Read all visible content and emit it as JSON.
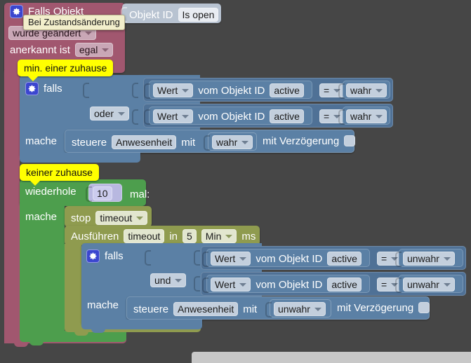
{
  "workspace": {
    "background_color": "#464646",
    "tooltip": "Bei Zustandsänderung"
  },
  "trigger_block": {
    "color": "#a1576f",
    "gear_icon": "gear-icon",
    "title": "Falls Objekt",
    "change_mode": "wurde geändert",
    "ack_label": "anerkannt ist",
    "ack_value": "egal",
    "object_input": {
      "label": "Objekt ID",
      "value": "Is open",
      "color": "#b8c3d1"
    }
  },
  "comments": {
    "first": "min. einer zuhause",
    "second": "keiner zuhause"
  },
  "if_block_1": {
    "color": "#5b80a5",
    "gear_icon": "gear-icon",
    "if_label": "falls",
    "operator": "oder",
    "do_label": "mache",
    "conditions": [
      {
        "value_label": "Wert",
        "text": "vom Objekt ID",
        "object_id": "active",
        "comparator": "=",
        "compare_to": "wahr"
      },
      {
        "value_label": "Wert",
        "text": "vom Objekt ID",
        "object_id": "active",
        "comparator": "=",
        "compare_to": "wahr"
      }
    ],
    "action": {
      "verb": "steuere",
      "target": "Anwesenheit",
      "with_label": "mit",
      "value": "wahr",
      "delay_label": "mit Verzögerung",
      "delay_checked": false
    }
  },
  "repeat_block": {
    "color": "#4d9e4d",
    "repeat_label": "wiederhole",
    "times": "10",
    "times_suffix": "mal:",
    "do_label": "mache"
  },
  "stop_block": {
    "color": "#8f9b4f",
    "label": "stop",
    "timer_name": "timeout"
  },
  "exec_block": {
    "color": "#8f9b4f",
    "label": "Ausführen",
    "timer_name": "timeout",
    "in_label": "in",
    "amount": "5",
    "unit": "Min",
    "unit_suffix": "ms"
  },
  "if_block_2": {
    "color": "#5b80a5",
    "gear_icon": "gear-icon",
    "if_label": "falls",
    "operator": "und",
    "do_label": "mache",
    "conditions": [
      {
        "value_label": "Wert",
        "text": "vom Objekt ID",
        "object_id": "active",
        "comparator": "=",
        "compare_to": "unwahr"
      },
      {
        "value_label": "Wert",
        "text": "vom Objekt ID",
        "object_id": "active",
        "comparator": "=",
        "compare_to": "unwahr"
      }
    ],
    "action": {
      "verb": "steuere",
      "target": "Anwesenheit",
      "with_label": "mit",
      "value": "unwahr",
      "delay_label": "mit Verzögerung",
      "delay_checked": false
    }
  }
}
